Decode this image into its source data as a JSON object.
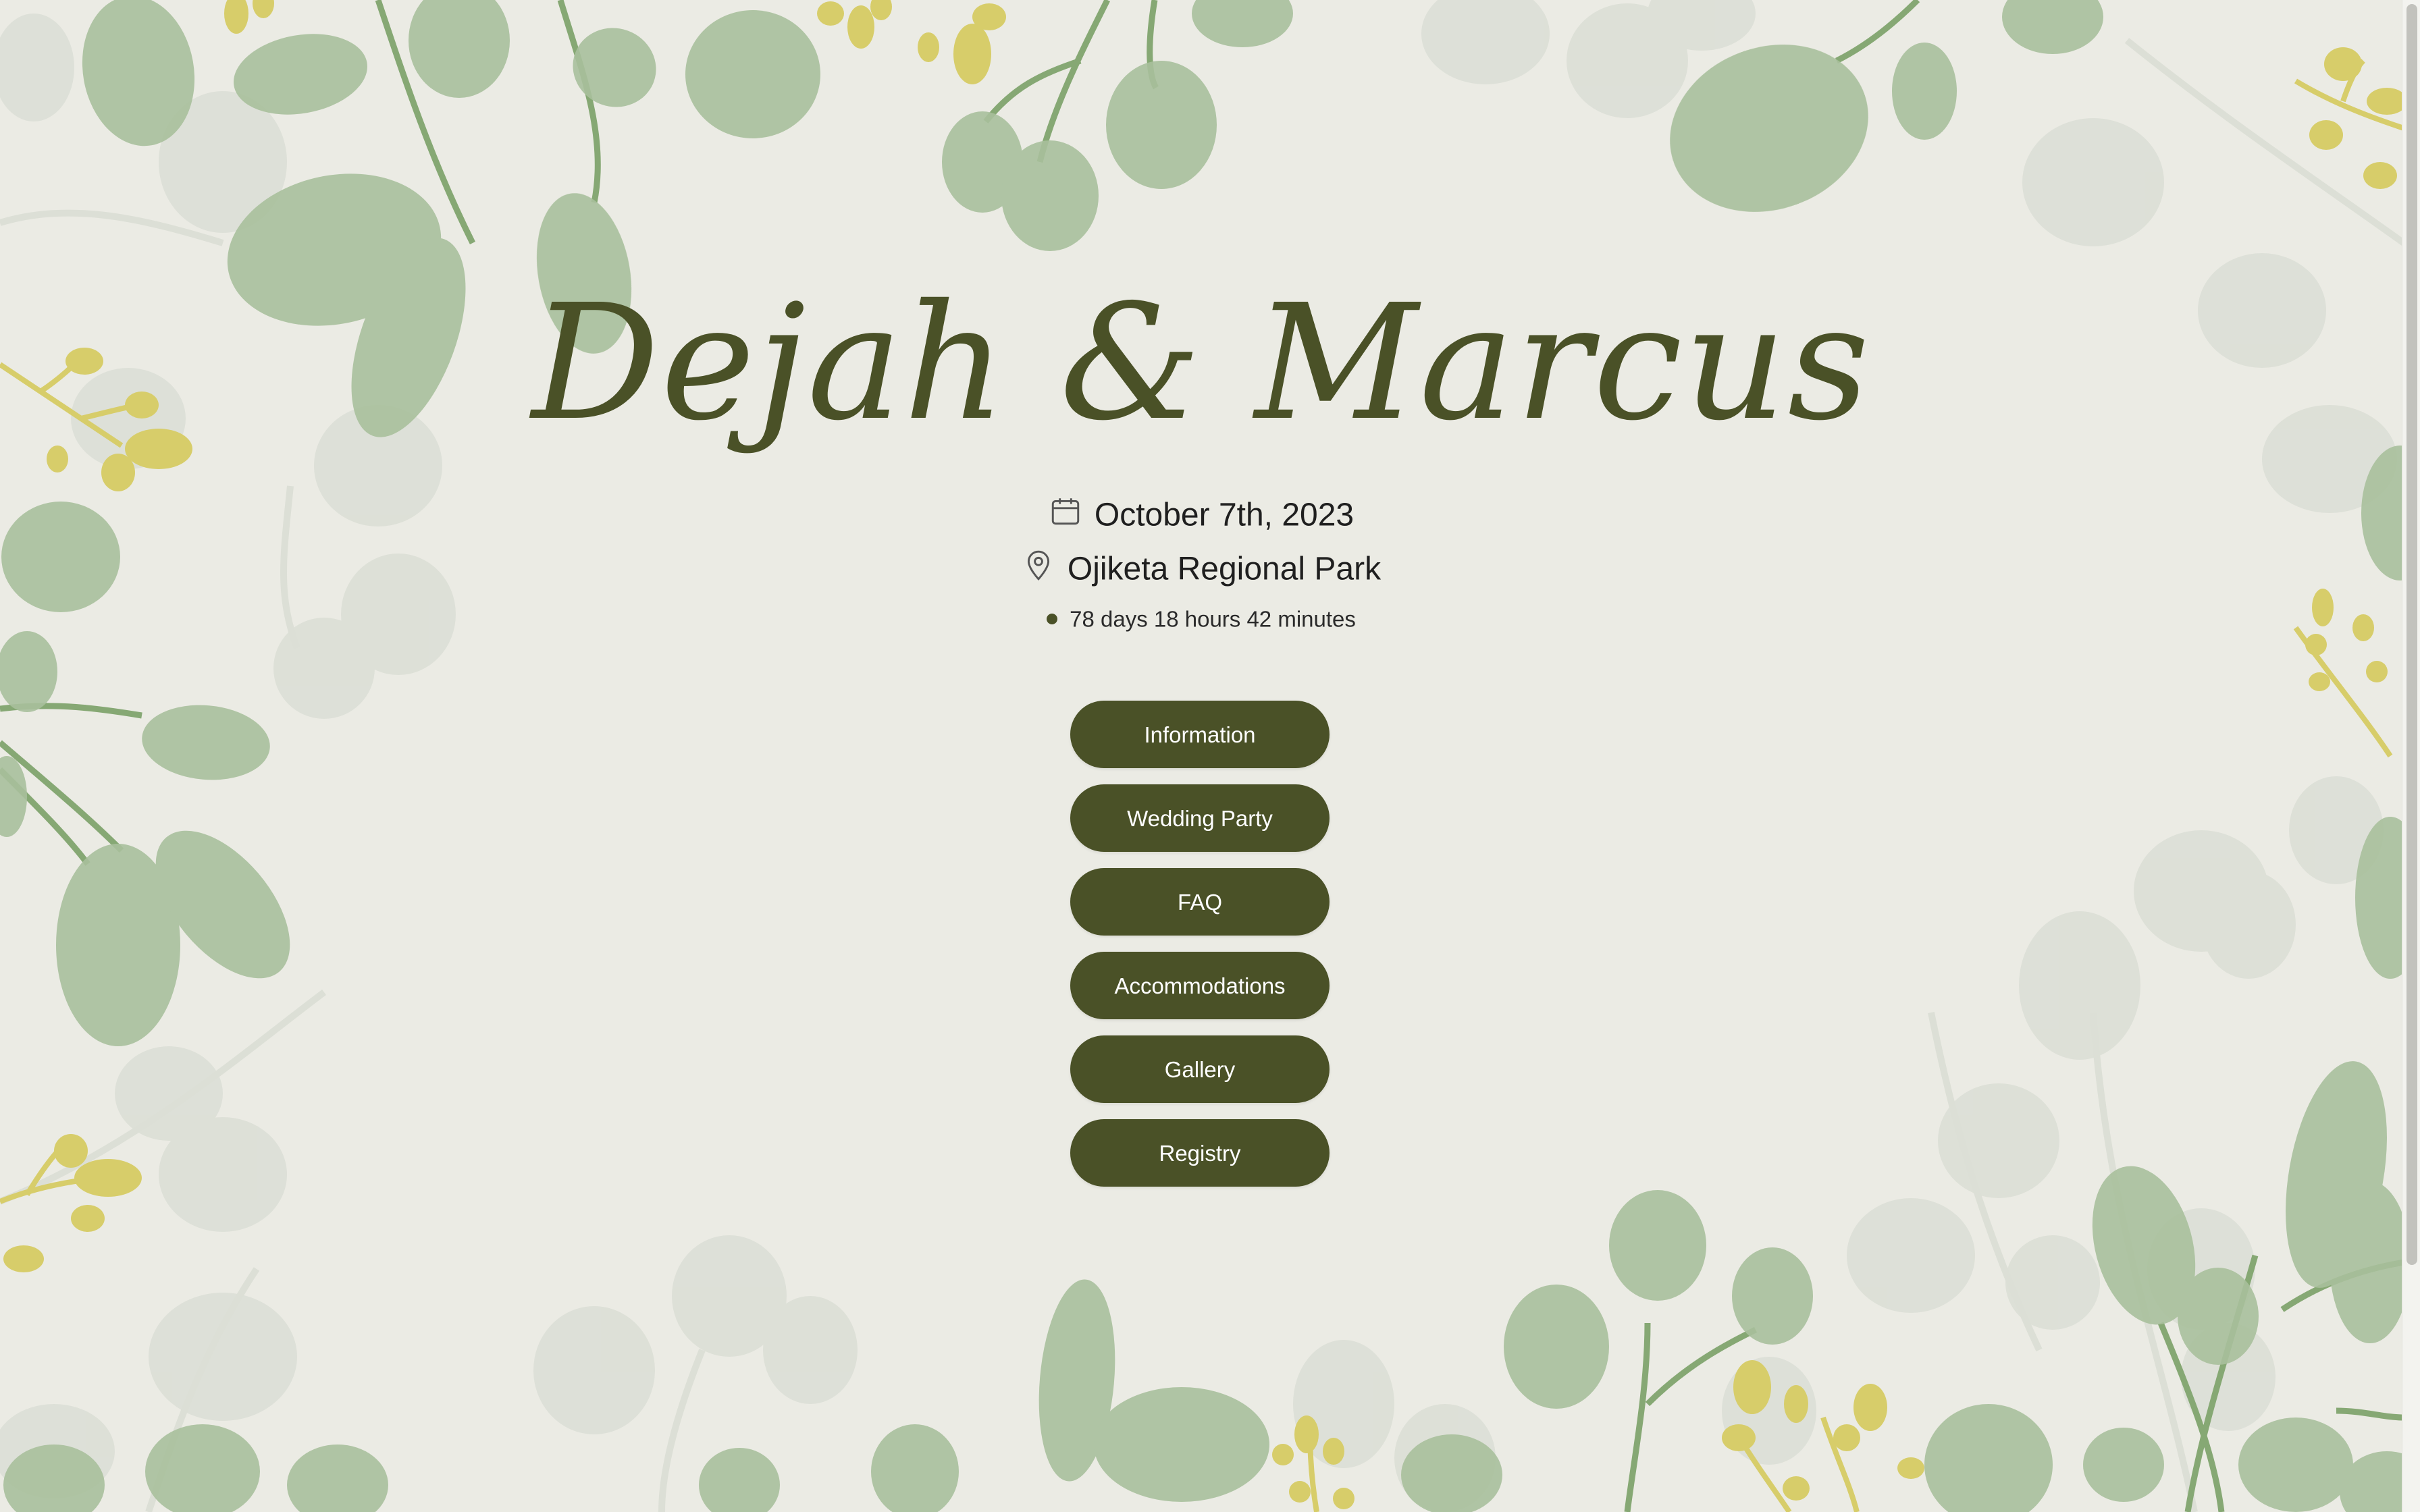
{
  "couple": {
    "names": "Dejah & Marcus"
  },
  "event": {
    "date": "October 7th, 2023",
    "venue": "Ojiketa Regional Park",
    "countdown": "78 days 18 hours 42 minutes"
  },
  "icons": {
    "date": "calendar-icon",
    "venue": "location-pin-icon",
    "countdown": "dot-icon"
  },
  "nav": {
    "items": [
      {
        "label": "Information"
      },
      {
        "label": "Wedding Party"
      },
      {
        "label": "FAQ"
      },
      {
        "label": "Accommodations"
      },
      {
        "label": "Gallery"
      },
      {
        "label": "Registry"
      }
    ]
  },
  "colors": {
    "background": "#ebebe4",
    "accent": "#4a5127",
    "leaf_green": "#a9c09c",
    "leaf_faded": "#dcdfd6",
    "berry_yellow": "#d7cd6a"
  }
}
